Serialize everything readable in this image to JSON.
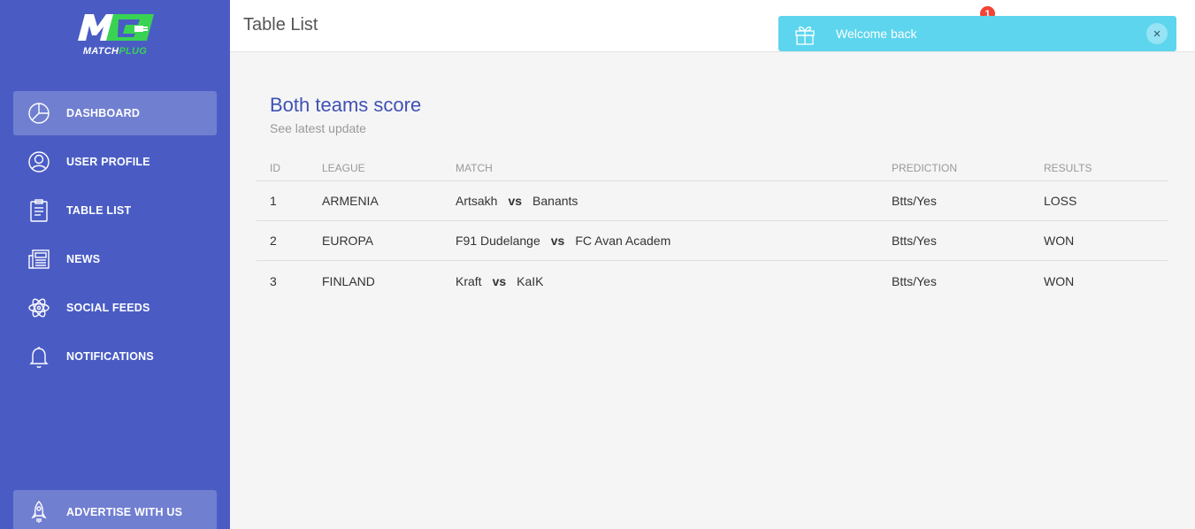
{
  "sidebar": {
    "logo": {
      "mark": "M",
      "brand_white": "MATCH",
      "brand_green": "PLUG"
    },
    "items": [
      {
        "label": "DASHBOARD",
        "icon": "pie-chart-icon",
        "active": true
      },
      {
        "label": "USER PROFILE",
        "icon": "user-icon",
        "active": false
      },
      {
        "label": "TABLE LIST",
        "icon": "clipboard-icon",
        "active": false
      },
      {
        "label": "NEWS",
        "icon": "newspaper-icon",
        "active": false
      },
      {
        "label": "SOCIAL FEEDS",
        "icon": "atom-icon",
        "active": false
      },
      {
        "label": "NOTIFICATIONS",
        "icon": "bell-icon",
        "active": false
      }
    ],
    "advertise_label": "ADVERTISE WITH US"
  },
  "header": {
    "title": "Table List",
    "notification_count": "1"
  },
  "toast": {
    "message": "Welcome back",
    "close_symbol": "×"
  },
  "card": {
    "title": "Both teams score",
    "subtitle": "See latest update"
  },
  "table": {
    "columns": [
      "ID",
      "LEAGUE",
      "MATCH",
      "PREDICTION",
      "RESULTS"
    ],
    "rows": [
      {
        "id": "1",
        "league": "ARMENIA",
        "home": "Artsakh",
        "vs": "vs",
        "away": "Banants",
        "prediction": "Btts/Yes",
        "result": "LOSS"
      },
      {
        "id": "2",
        "league": "EUROPA",
        "home": "F91 Dudelange",
        "vs": "vs",
        "away": "FC Avan Academ",
        "prediction": "Btts/Yes",
        "result": "WON"
      },
      {
        "id": "3",
        "league": "FINLAND",
        "home": "Kraft",
        "vs": "vs",
        "away": "KaIK",
        "prediction": "Btts/Yes",
        "result": "WON"
      }
    ]
  },
  "colors": {
    "sidebar_bg": "#4a5cc4",
    "accent": "#3f51b5",
    "toast_bg": "#5dd5ee",
    "badge": "#f44336",
    "logo_green": "#39d353"
  }
}
